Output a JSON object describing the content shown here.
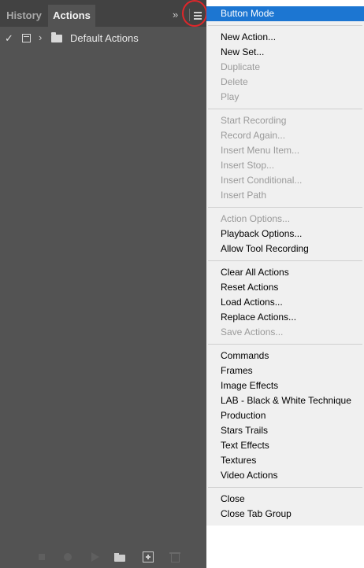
{
  "tabs": {
    "history": "History",
    "actions": "Actions"
  },
  "panel": {
    "expand_glyph": "»",
    "set_row": {
      "check_glyph": "✓",
      "chevron_glyph": "›",
      "label": "Default Actions"
    }
  },
  "menu": {
    "button_mode": "Button Mode",
    "new_action": "New Action...",
    "new_set": "New Set...",
    "duplicate": "Duplicate",
    "delete": "Delete",
    "play": "Play",
    "start_recording": "Start Recording",
    "record_again": "Record Again...",
    "insert_menu_item": "Insert Menu Item...",
    "insert_stop": "Insert Stop...",
    "insert_conditional": "Insert Conditional...",
    "insert_path": "Insert Path",
    "action_options": "Action Options...",
    "playback_options": "Playback Options...",
    "allow_tool_recording": "Allow Tool Recording",
    "clear_all_actions": "Clear All Actions",
    "reset_actions": "Reset Actions",
    "load_actions": "Load Actions...",
    "replace_actions": "Replace Actions...",
    "save_actions": "Save Actions...",
    "commands": "Commands",
    "frames": "Frames",
    "image_effects": "Image Effects",
    "lab_bw": "LAB - Black & White Technique",
    "production": "Production",
    "stars_trails": "Stars Trails",
    "text_effects": "Text Effects",
    "textures": "Textures",
    "video_actions": "Video Actions",
    "close": "Close",
    "close_tab_group": "Close Tab Group"
  },
  "colors": {
    "panel_bg": "#535353",
    "tabbar_bg": "#424242",
    "menu_bg": "#f0f0f0",
    "menu_selected": "#1c76d2",
    "menu_disabled_text": "#9a9a9a",
    "highlight_ring": "#e0262a"
  },
  "icons": {
    "bottom_bar": [
      "stop-icon",
      "record-icon",
      "play-icon",
      "new-set-icon",
      "new-action-icon",
      "delete-icon"
    ]
  }
}
